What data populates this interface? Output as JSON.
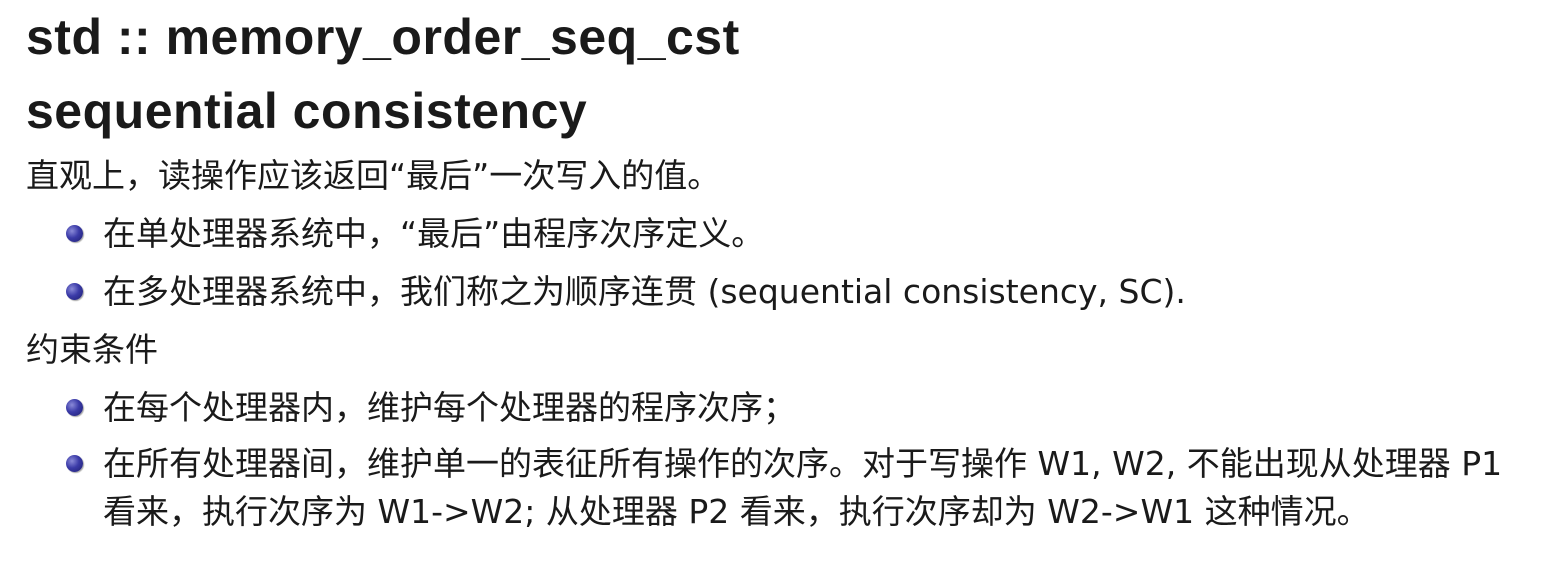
{
  "title_line1": "std :: memory_order_seq_cst",
  "title_line2": "sequential consistency",
  "intro": "直观上，读操作应该返回“最后”一次写入的值。",
  "intro_items": [
    "在单处理器系统中，“最后”由程序次序定义。",
    "在多处理器系统中，我们称之为顺序连贯 (sequential consistency, SC)."
  ],
  "constraints_heading": "约束条件",
  "constraint_items": [
    "在每个处理器内，维护每个处理器的程序次序；",
    "在所有处理器间，维护单一的表征所有操作的次序。对于写操作 W1, W2, 不能出现从处理器 P1 看来，执行次序为 W1->W2; 从处理器 P2 看来，执行次序却为 W2->W1 这种情况。"
  ],
  "colors": {
    "bullet": "#3b3ba8",
    "text": "#1a1a1a"
  }
}
